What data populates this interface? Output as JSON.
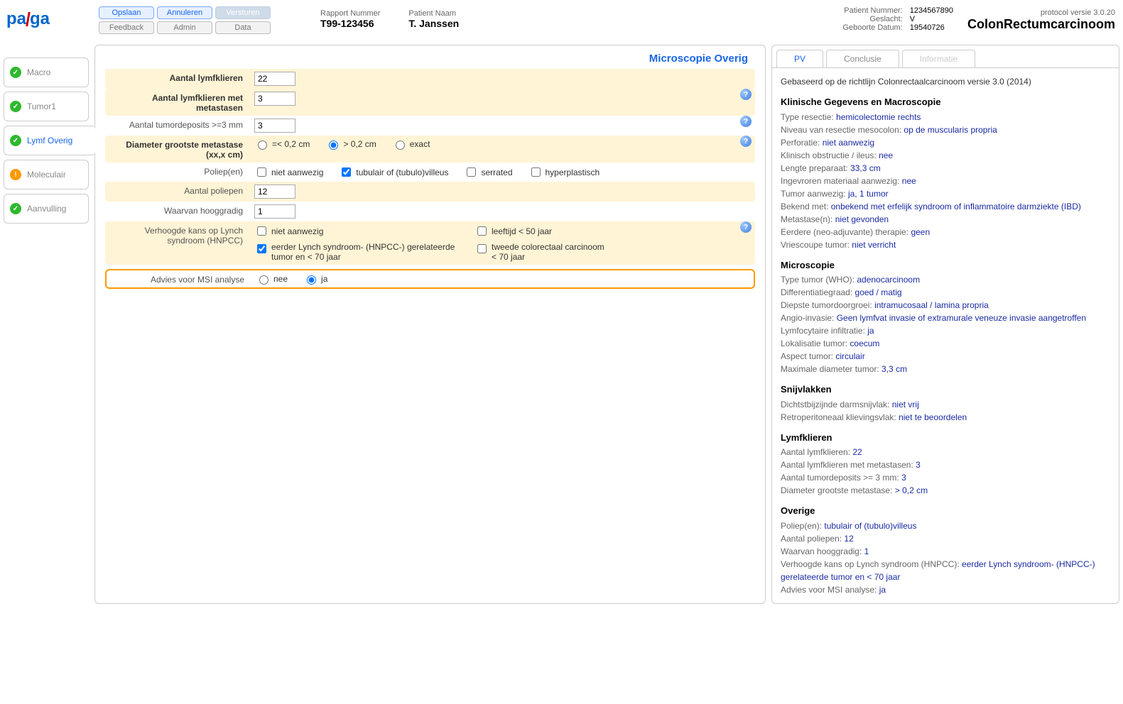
{
  "logo": {
    "text": "palga"
  },
  "buttons": {
    "opslaan": "Opslaan",
    "annuleren": "Annuleren",
    "versturen": "Versturen",
    "feedback": "Feedback",
    "admin": "Admin",
    "data": "Data"
  },
  "header": {
    "rapport_label": "Rapport Nummer",
    "rapport_value": "T99-123456",
    "patient_label": "Patient Naam",
    "patient_value": "T. Janssen",
    "patientnr_label": "Patient Nummer:",
    "patientnr_value": "1234567890",
    "geslacht_label": "Geslacht:",
    "geslacht_value": "V",
    "geboorte_label": "Geboorte Datum:",
    "geboorte_value": "19540726",
    "protocol_version": "protocol versie 3.0.20",
    "title": "ColonRectumcarcinoom"
  },
  "nav": {
    "macro": "Macro",
    "tumor1": "Tumor1",
    "lymf": "Lymf Overig",
    "moleculair": "Moleculair",
    "aanvulling": "Aanvulling"
  },
  "section_title": "Microscopie Overig",
  "form": {
    "aantal_lymf_label": "Aantal lymfklieren",
    "aantal_lymf_value": "22",
    "aantal_lymf_met_label": "Aantal lymfklieren met metastasen",
    "aantal_lymf_met_value": "3",
    "tumord_label": "Aantal tumordeposits >=3 mm",
    "tumord_value": "3",
    "diameter_label": "Diameter grootste metastase (xx,x cm)",
    "diameter_opts": {
      "a": "=< 0,2 cm",
      "b": "> 0,2 cm",
      "c": "exact"
    },
    "poliep_label": "Poliep(en)",
    "poliep_opts": {
      "a": "niet aanwezig",
      "b": "tubulair of (tubulo)villeus",
      "c": "serrated",
      "d": "hyperplastisch"
    },
    "aantal_poliep_label": "Aantal poliepen",
    "aantal_poliep_value": "12",
    "hooggradig_label": "Waarvan hooggradig",
    "hooggradig_value": "1",
    "lynch_label": "Verhoogde kans op Lynch syndroom (HNPCC)",
    "lynch_opts": {
      "a": "niet aanwezig",
      "b": "leeftijd < 50 jaar",
      "c": "eerder Lynch syndroom- (HNPCC-) gerelateerde tumor en < 70 jaar",
      "d": "tweede colorectaal carcinoom < 70 jaar"
    },
    "msi_label": "Advies voor MSI analyse",
    "msi_opts": {
      "nee": "nee",
      "ja": "ja"
    }
  },
  "tabs_right": {
    "pv": "PV",
    "conclusie": "Conclusie",
    "informatie": "Informatie"
  },
  "report": {
    "intro": "Gebaseerd op de richtlijn Colonrectaalcarcinoom versie 3.0 (2014)",
    "s1_title": "Klinische Gegevens en Macroscopie",
    "s1": [
      [
        "Type resectie:",
        "hemicolectomie rechts"
      ],
      [
        "Niveau van resectie mesocolon:",
        "op de muscularis propria"
      ],
      [
        "Perforatie:",
        "niet aanwezig"
      ],
      [
        "Klinisch obstructie / ileus:",
        "nee"
      ],
      [
        "Lengte preparaat:",
        "33,3 cm"
      ],
      [
        "Ingevroren materiaal aanwezig:",
        "nee"
      ],
      [
        "Tumor aanwezig:",
        "ja, 1 tumor"
      ],
      [
        "Bekend met:",
        "onbekend met erfelijk syndroom of inflammatoire darmziekte (IBD)"
      ],
      [
        "Metastase(n):",
        "niet gevonden"
      ],
      [
        "Eerdere (neo-adjuvante) therapie:",
        "geen"
      ],
      [
        "Vriescoupe tumor:",
        "niet verricht"
      ]
    ],
    "s2_title": "Microscopie",
    "s2": [
      [
        "Type tumor (WHO):",
        "adenocarcinoom"
      ],
      [
        "Differentiatiegraad:",
        "goed / matig"
      ],
      [
        "Diepste tumordoorgroei:",
        "intramucosaal / lamina propria"
      ],
      [
        "Angio-invasie:",
        "Geen lymfvat invasie of extramurale veneuze invasie aangetroffen"
      ],
      [
        "Lymfocytaire infiltratie:",
        "ja"
      ],
      [
        "Lokalisatie tumor:",
        "coecum"
      ],
      [
        "Aspect tumor:",
        "circulair"
      ],
      [
        "Maximale diameter tumor:",
        "3,3 cm"
      ]
    ],
    "s3_title": "Snijvlakken",
    "s3": [
      [
        "Dichtstbijzijnde darmsnijvlak:",
        "niet vrij"
      ],
      [
        "Retroperitoneaal klievingsvlak:",
        "niet te beoordelen"
      ]
    ],
    "s4_title": "Lymfklieren",
    "s4": [
      [
        "Aantal lymfklieren:",
        "22"
      ],
      [
        "Aantal lymfklieren met metastasen:",
        "3"
      ],
      [
        "Aantal tumordeposits >= 3 mm:",
        "3"
      ],
      [
        "Diameter grootste metastase:",
        "> 0,2 cm"
      ]
    ],
    "s5_title": "Overige",
    "s5": [
      [
        "Poliep(en):",
        "tubulair of (tubulo)villeus"
      ],
      [
        "Aantal poliepen:",
        "12"
      ],
      [
        "Waarvan hooggradig:",
        "1"
      ],
      [
        "Verhoogde kans op Lynch syndroom (HNPCC):",
        "eerder Lynch syndroom- (HNPCC-) gerelateerde tumor en < 70 jaar"
      ],
      [
        "Advies voor MSI analyse:",
        "ja"
      ]
    ]
  }
}
